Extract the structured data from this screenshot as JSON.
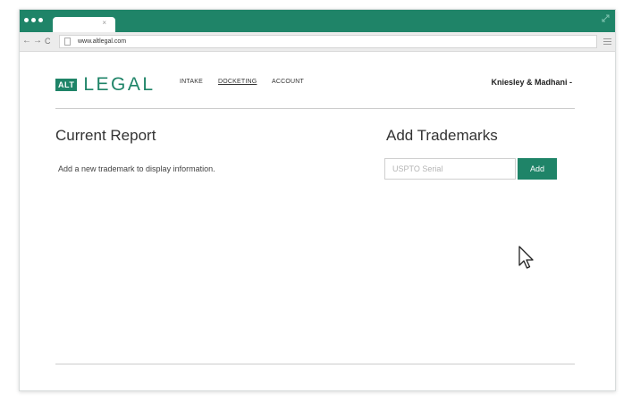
{
  "browser": {
    "url": "www.altlegal.com",
    "tab_close": "×",
    "nav": {
      "back": "←",
      "forward": "→",
      "reload": "C"
    },
    "accent_color": "#1f8468"
  },
  "header": {
    "logo_badge": "ALT",
    "logo_word": "LEGAL",
    "nav": [
      {
        "label": "INTAKE"
      },
      {
        "label": "DOCKETING",
        "active": true
      },
      {
        "label": "ACCOUNT"
      }
    ],
    "user_menu": "Kniesley & Madhani -"
  },
  "report": {
    "title": "Current Report",
    "empty_text": "Add a new trademark to display information."
  },
  "trademarks": {
    "title": "Add Trademarks",
    "serial_placeholder": "USPTO Serial",
    "serial_value": "",
    "add_label": "Add"
  },
  "icons": {
    "window_controls": "dots-icon",
    "expand": "expand-icon",
    "page": "page-icon",
    "menu": "hamburger-menu-icon",
    "cursor": "mouse-cursor-icon"
  }
}
